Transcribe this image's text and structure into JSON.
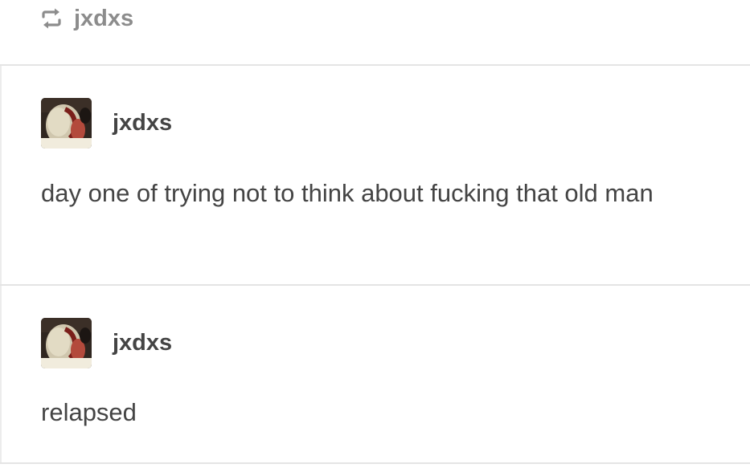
{
  "reblog": {
    "icon": "reblog-icon",
    "username": "jxdxs"
  },
  "posts": [
    {
      "username": "jxdxs",
      "avatar_icon": "avatar-photo",
      "text": "day one of trying not to think about fucking that old man"
    },
    {
      "username": "jxdxs",
      "avatar_icon": "avatar-photo",
      "text": "relapsed"
    }
  ],
  "colors": {
    "text": "#444444",
    "muted": "#8c8c8c",
    "divider": "#e4e4e4"
  }
}
